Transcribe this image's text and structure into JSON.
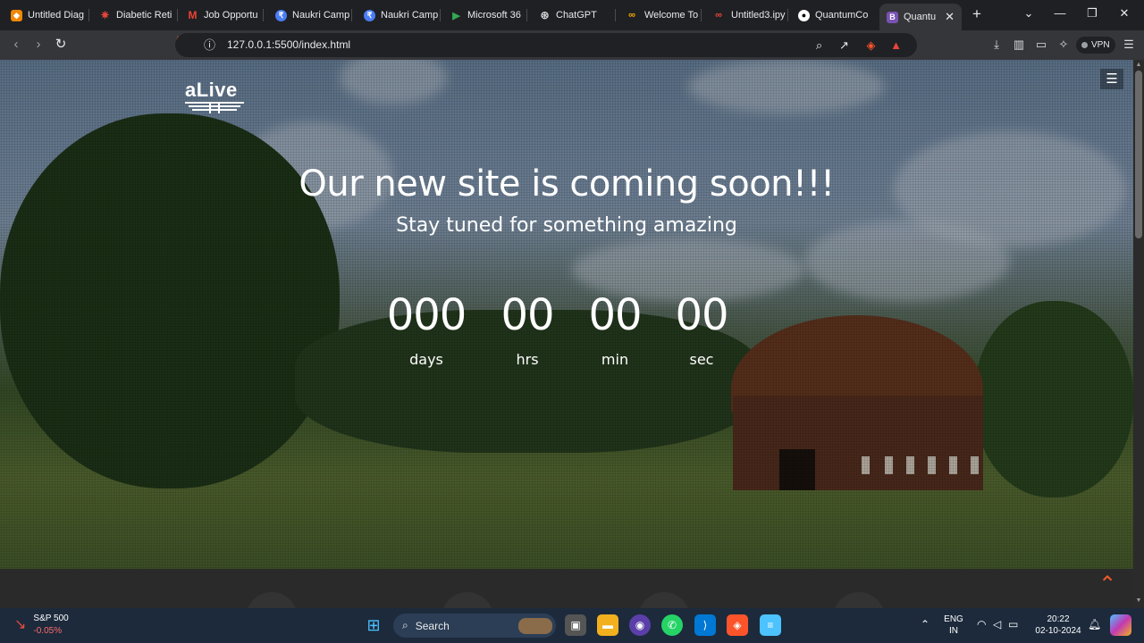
{
  "tabs": [
    {
      "label": "Untitled Diag",
      "icon": "drawio-icon",
      "color": "#f08705"
    },
    {
      "label": "Diabetic Reti",
      "icon": "star-burst-icon",
      "color": "#e8453c"
    },
    {
      "label": "Job Opportu",
      "icon": "gmail-icon",
      "color": "#ea4335"
    },
    {
      "label": "Naukri Camp",
      "icon": "naukri-icon",
      "color": "#4a7cf6"
    },
    {
      "label": "Naukri Camp",
      "icon": "naukri-icon",
      "color": "#4a7cf6"
    },
    {
      "label": "Microsoft 36",
      "icon": "play-icon",
      "color": "#34a853"
    },
    {
      "label": "ChatGPT",
      "icon": "openai-icon",
      "color": "#cccccc"
    },
    {
      "label": "Welcome To",
      "icon": "colab-icon",
      "color": "#f9ab00"
    },
    {
      "label": "Untitled3.ipy",
      "icon": "colab-icon",
      "color": "#e8453c"
    },
    {
      "label": "QuantumCo",
      "icon": "github-icon",
      "color": "#ffffff"
    },
    {
      "label": "Quantu",
      "icon": "bootstrap-icon",
      "color": "#7952b3",
      "active": true
    }
  ],
  "toolbar": {
    "url": "127.0.0.1:5500/index.html",
    "vpn_label": "VPN"
  },
  "page": {
    "logo_text": "aLive",
    "headline": "Our new site is coming soon!!!",
    "subline": "Stay tuned for something amazing",
    "countdown": [
      {
        "value": "000",
        "label": "days"
      },
      {
        "value": "00",
        "label": "hrs"
      },
      {
        "value": "00",
        "label": "min"
      },
      {
        "value": "00",
        "label": "sec"
      }
    ],
    "accent_color": "#f05a28"
  },
  "taskbar": {
    "stock_name": "S&P 500",
    "stock_change": "-0.05%",
    "search_label": "Search",
    "lang_line1": "ENG",
    "lang_line2": "IN",
    "time": "20:22",
    "date": "02-10-2024"
  }
}
